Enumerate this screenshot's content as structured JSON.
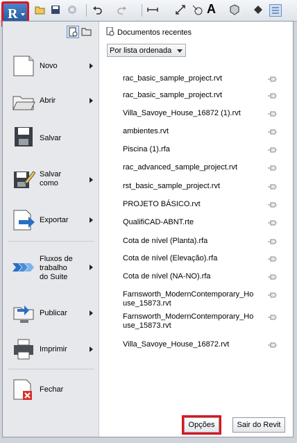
{
  "left_menu": {
    "new": "Novo",
    "open": "Abrir",
    "save": "Salvar",
    "save_as": [
      "Salvar",
      "como"
    ],
    "export": "Exportar",
    "suite": [
      "Fluxos de",
      "trabalho",
      "do Suite"
    ],
    "publish": "Publicar",
    "print": "Imprimir",
    "close": "Fechar"
  },
  "recent": {
    "header": "Documentos recentes",
    "sort_selected": "Por lista ordenada",
    "files": [
      "rac_basic_sample_project.rvt",
      "rac_basic_sample_project.rvt",
      "Villa_Savoye_House_16872 (1).rvt",
      "ambientes.rvt",
      "Piscina (1).rfa",
      "rac_advanced_sample_project.rvt",
      "rst_basic_sample_project.rvt",
      "PROJETO BÁSICO.rvt",
      "QualifiCAD-ABNT.rte",
      "Cota de nível (Planta).rfa",
      "Cota de nível (Elevação).rfa",
      "Cota de nível (NA-NO).rfa",
      [
        "Farnsworth_ModernContemporary_Ho",
        "use_15873.rvt"
      ],
      [
        "Farnsworth_ModernContemporary_Ho",
        "use_15873.rvt"
      ],
      "Villa_Savoye_House_16872.rvt"
    ]
  },
  "buttons": {
    "options": "Opções",
    "exit": "Sair do Revit"
  },
  "toolbar": {
    "app_letter": "R",
    "text_glyph": "A"
  },
  "colors": {
    "highlight": "#e0141e",
    "accent": "#2a6fc4"
  }
}
